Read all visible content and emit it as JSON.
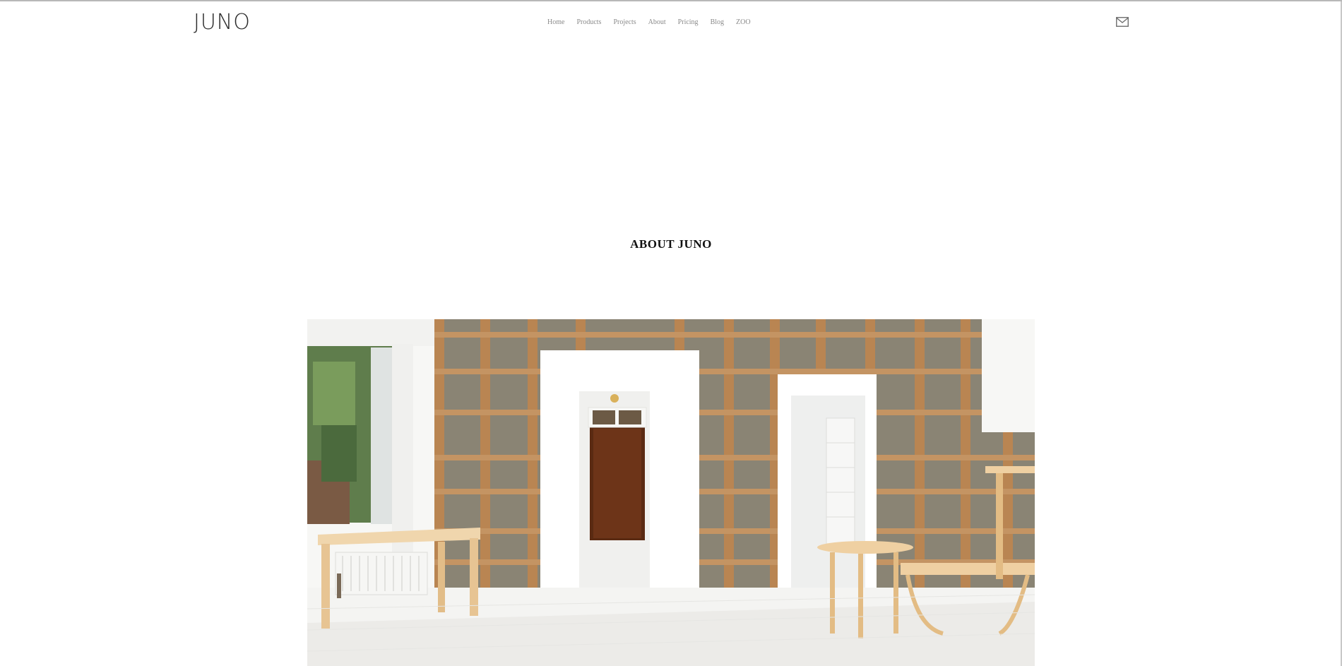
{
  "header": {
    "logo": "JUNO",
    "nav": [
      {
        "label": "Home"
      },
      {
        "label": "Products"
      },
      {
        "label": "Projects"
      },
      {
        "label": "About"
      },
      {
        "label": "Pricing"
      },
      {
        "label": "Blog"
      },
      {
        "label": "ZOO"
      }
    ],
    "mail_icon": "envelope-icon"
  },
  "main": {
    "title": "ABOUT JUNO"
  },
  "colors": {
    "nav_text": "#8a8a8a",
    "title_text": "#111111",
    "shelf_wood": "#b98552",
    "shelf_back": "#8a8474"
  }
}
